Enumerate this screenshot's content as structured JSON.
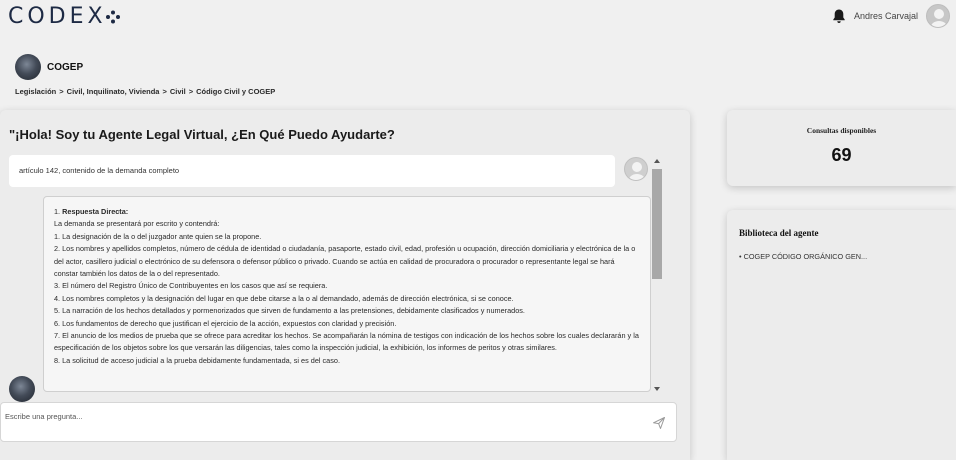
{
  "brand": {
    "logo_text": "CODEX"
  },
  "user": {
    "name": "Andres Carvajal"
  },
  "agent": {
    "name": "COGEP"
  },
  "breadcrumb": [
    "Legislación",
    ">",
    "Civil, Inquilinato, Vivienda",
    ">",
    "Civil",
    ">",
    "Código Civil y COGEP"
  ],
  "chat": {
    "title": "\"¡Hola! Soy tu Agente Legal Virtual, ¿En Qué Puedo Ayudarte?",
    "user_message": "artículo 142, contenido de la demanda completo",
    "bot_response": {
      "first_number": "1. ",
      "first_heading": "Respuesta Directa:",
      "lines": [
        "La demanda se presentará por escrito y contendrá:",
        "1. La designación de la o del juzgador ante quien se la propone.",
        "2. Los nombres y apellidos completos, número de cédula de identidad o ciudadanía, pasaporte, estado civil, edad, profesión u ocupación, dirección domiciliaria y electrónica de la o del actor, casillero judicial o electrónico de su defensora o defensor público o privado. Cuando se actúa en calidad de procuradora o procurador o representante legal se hará constar también los datos de la o del representado.",
        "3. El número del Registro Único de Contribuyentes en los casos que así se requiera.",
        "4. Los nombres completos y la designación del lugar en que debe citarse a la o al demandado, además de dirección electrónica, si se conoce.",
        "5. La narración de los hechos detallados y pormenorizados que sirven de fundamento a las pretensiones, debidamente clasificados y numerados.",
        "6. Los fundamentos de derecho que justifican el ejercicio de la acción, expuestos con claridad y precisión.",
        "7. El anuncio de los medios de prueba que se ofrece para acreditar los hechos. Se acompañarán la nómina de testigos con indicación de los hechos sobre los cuales declararán y la especificación de los objetos sobre los que versarán las diligencias, tales como la inspección judicial, la exhibición, los informes de peritos y otras similares.",
        "8. La solicitud de acceso judicial a la prueba debidamente fundamentada, si es del caso."
      ]
    },
    "input_placeholder": "Escribe una pregunta..."
  },
  "stats": {
    "label": "Consultas disponibles",
    "value": "69"
  },
  "library": {
    "title": "Biblioteca del agente",
    "items": [
      "• COGEP CÓDIGO ORGÁNICO GEN..."
    ]
  },
  "colors": {
    "logo": "#1d2a44",
    "card_bg": "#ececec",
    "page_bg": "#f0f0f0"
  },
  "icons": [
    "logo-mark-icon",
    "bell-icon",
    "user-avatar-icon",
    "send-icon",
    "scroll-up-icon",
    "scroll-down-icon"
  ]
}
